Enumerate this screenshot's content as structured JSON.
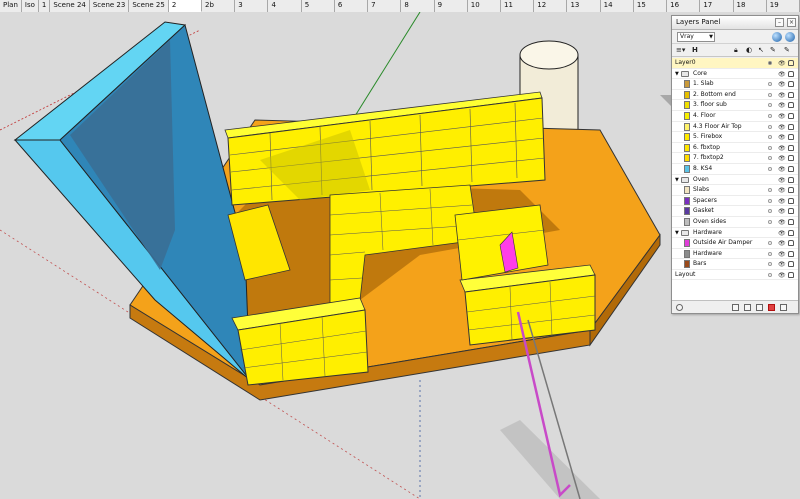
{
  "scene_tabs": [
    "Plan",
    "Iso",
    "1",
    "Scene 24",
    "Scene 23",
    "Scene 25",
    "2",
    "2b",
    "3",
    "4",
    "5",
    "6",
    "7",
    "8",
    "9",
    "10",
    "11",
    "12",
    "13",
    "14",
    "15",
    "16",
    "17",
    "18",
    "19"
  ],
  "selected_tab": "2",
  "layers_panel": {
    "title": "Layers Panel",
    "renderer": "Vray",
    "toolbar": {
      "col_h": "H"
    },
    "layers": [
      {
        "name": "Layer0",
        "kind": "top",
        "color": "#f4e6b0"
      },
      {
        "name": "Core",
        "kind": "group"
      },
      {
        "name": "1. Slab",
        "kind": "layer",
        "color": "#c99a3a"
      },
      {
        "name": "2. Bottom end",
        "kind": "layer",
        "color": "#e6c000"
      },
      {
        "name": "3. floor sub",
        "kind": "layer",
        "color": "#f0e000"
      },
      {
        "name": "4. Floor",
        "kind": "layer",
        "color": "#f7ef00"
      },
      {
        "name": "4.3 Floor Air Top",
        "kind": "layer",
        "color": "#fff36a"
      },
      {
        "name": "5. Firebox",
        "kind": "layer",
        "color": "#ffea00"
      },
      {
        "name": "6. fbxtop",
        "kind": "layer",
        "color": "#ffe600"
      },
      {
        "name": "7. fbxtop2",
        "kind": "layer",
        "color": "#ffdc00"
      },
      {
        "name": "8. KS4",
        "kind": "layer",
        "color": "#5bc3e6"
      },
      {
        "name": "Oven",
        "kind": "group"
      },
      {
        "name": "Slabs",
        "kind": "layer",
        "color": "#f2e4c0"
      },
      {
        "name": "Spacers",
        "kind": "layer",
        "color": "#7a2fc0"
      },
      {
        "name": "Gasket",
        "kind": "layer",
        "color": "#5a3aa0"
      },
      {
        "name": "Oven sides",
        "kind": "layer",
        "color": "#bdbdbd"
      },
      {
        "name": "Hardware",
        "kind": "group"
      },
      {
        "name": "Outside Air Damper",
        "kind": "layer",
        "color": "#e03ed8"
      },
      {
        "name": "Hardware",
        "kind": "layer",
        "color": "#8c8c8c"
      },
      {
        "name": "Bars",
        "kind": "layer",
        "color": "#9a4a1a"
      },
      {
        "name": "Layout",
        "kind": "top",
        "color": "#f0d0c0"
      }
    ]
  }
}
